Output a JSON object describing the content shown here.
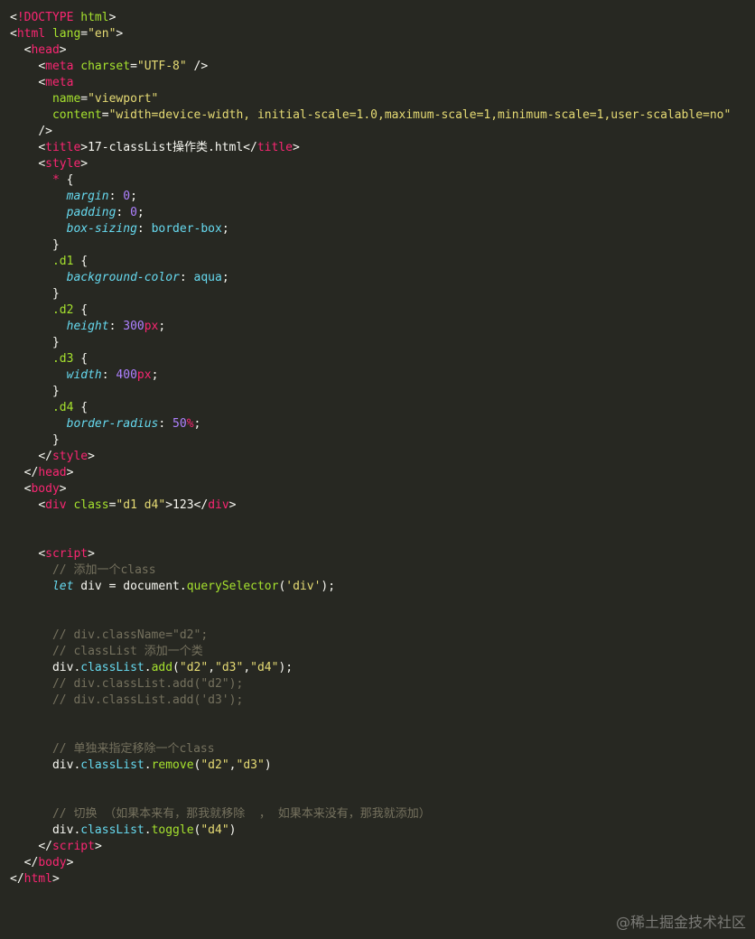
{
  "editor": {
    "lines": [
      [
        [
          "punct",
          "<"
        ],
        [
          "tag",
          "!DOCTYPE"
        ],
        [
          "text",
          " "
        ],
        [
          "attr",
          "html"
        ],
        [
          "punct",
          ">"
        ]
      ],
      [
        [
          "punct",
          "<"
        ],
        [
          "tag",
          "html"
        ],
        [
          "text",
          " "
        ],
        [
          "attr",
          "lang"
        ],
        [
          "punct",
          "="
        ],
        [
          "string",
          "\"en\""
        ],
        [
          "punct",
          ">"
        ]
      ],
      [
        [
          "text",
          "  "
        ],
        [
          "punct",
          "<"
        ],
        [
          "tag",
          "head"
        ],
        [
          "punct",
          ">"
        ]
      ],
      [
        [
          "text",
          "    "
        ],
        [
          "punct",
          "<"
        ],
        [
          "tag",
          "meta"
        ],
        [
          "text",
          " "
        ],
        [
          "attr",
          "charset"
        ],
        [
          "punct",
          "="
        ],
        [
          "string",
          "\"UTF-8\""
        ],
        [
          "text",
          " "
        ],
        [
          "punct",
          "/>"
        ]
      ],
      [
        [
          "text",
          "    "
        ],
        [
          "punct",
          "<"
        ],
        [
          "tag",
          "meta"
        ]
      ],
      [
        [
          "text",
          "      "
        ],
        [
          "attr",
          "name"
        ],
        [
          "punct",
          "="
        ],
        [
          "string",
          "\"viewport\""
        ]
      ],
      [
        [
          "text",
          "      "
        ],
        [
          "attr",
          "content"
        ],
        [
          "punct",
          "="
        ],
        [
          "string",
          "\"width=device-width, initial-scale=1.0,maximum-scale=1,minimum-scale=1,user-scalable=no\""
        ]
      ],
      [
        [
          "text",
          "    "
        ],
        [
          "punct",
          "/>"
        ]
      ],
      [
        [
          "text",
          "    "
        ],
        [
          "punct",
          "<"
        ],
        [
          "tag",
          "title"
        ],
        [
          "punct",
          ">"
        ],
        [
          "text",
          "17-classList操作类.html"
        ],
        [
          "punct",
          "</"
        ],
        [
          "tag",
          "title"
        ],
        [
          "punct",
          ">"
        ]
      ],
      [
        [
          "text",
          "    "
        ],
        [
          "punct",
          "<"
        ],
        [
          "tag",
          "style"
        ],
        [
          "punct",
          ">"
        ]
      ],
      [
        [
          "text",
          "      "
        ],
        [
          "star",
          "*"
        ],
        [
          "text",
          " "
        ],
        [
          "punct",
          "{"
        ]
      ],
      [
        [
          "text",
          "        "
        ],
        [
          "prop",
          "margin"
        ],
        [
          "punct",
          ": "
        ],
        [
          "number",
          "0"
        ],
        [
          "punct",
          ";"
        ]
      ],
      [
        [
          "text",
          "        "
        ],
        [
          "prop",
          "padding"
        ],
        [
          "punct",
          ": "
        ],
        [
          "number",
          "0"
        ],
        [
          "punct",
          ";"
        ]
      ],
      [
        [
          "text",
          "        "
        ],
        [
          "prop",
          "box-sizing"
        ],
        [
          "punct",
          ": "
        ],
        [
          "value",
          "border-box"
        ],
        [
          "punct",
          ";"
        ]
      ],
      [
        [
          "text",
          "      "
        ],
        [
          "punct",
          "}"
        ]
      ],
      [
        [
          "text",
          "      "
        ],
        [
          "selector",
          ".d1"
        ],
        [
          "text",
          " "
        ],
        [
          "punct",
          "{"
        ]
      ],
      [
        [
          "text",
          "        "
        ],
        [
          "prop",
          "background-color"
        ],
        [
          "punct",
          ": "
        ],
        [
          "value",
          "aqua"
        ],
        [
          "punct",
          ";"
        ]
      ],
      [
        [
          "text",
          "      "
        ],
        [
          "punct",
          "}"
        ]
      ],
      [
        [
          "text",
          "      "
        ],
        [
          "selector",
          ".d2"
        ],
        [
          "text",
          " "
        ],
        [
          "punct",
          "{"
        ]
      ],
      [
        [
          "text",
          "        "
        ],
        [
          "prop",
          "height"
        ],
        [
          "punct",
          ": "
        ],
        [
          "number",
          "300"
        ],
        [
          "unit",
          "px"
        ],
        [
          "punct",
          ";"
        ]
      ],
      [
        [
          "text",
          "      "
        ],
        [
          "punct",
          "}"
        ]
      ],
      [
        [
          "text",
          "      "
        ],
        [
          "selector",
          ".d3"
        ],
        [
          "text",
          " "
        ],
        [
          "punct",
          "{"
        ]
      ],
      [
        [
          "text",
          "        "
        ],
        [
          "prop",
          "width"
        ],
        [
          "punct",
          ": "
        ],
        [
          "number",
          "400"
        ],
        [
          "unit",
          "px"
        ],
        [
          "punct",
          ";"
        ]
      ],
      [
        [
          "text",
          "      "
        ],
        [
          "punct",
          "}"
        ]
      ],
      [
        [
          "text",
          "      "
        ],
        [
          "selector",
          ".d4"
        ],
        [
          "text",
          " "
        ],
        [
          "punct",
          "{"
        ]
      ],
      [
        [
          "text",
          "        "
        ],
        [
          "prop",
          "border-radius"
        ],
        [
          "punct",
          ": "
        ],
        [
          "number",
          "50"
        ],
        [
          "unit",
          "%"
        ],
        [
          "punct",
          ";"
        ]
      ],
      [
        [
          "text",
          "      "
        ],
        [
          "punct",
          "}"
        ]
      ],
      [
        [
          "text",
          "    "
        ],
        [
          "punct",
          "</"
        ],
        [
          "tag",
          "style"
        ],
        [
          "punct",
          ">"
        ]
      ],
      [
        [
          "text",
          "  "
        ],
        [
          "punct",
          "</"
        ],
        [
          "tag",
          "head"
        ],
        [
          "punct",
          ">"
        ]
      ],
      [
        [
          "text",
          "  "
        ],
        [
          "punct",
          "<"
        ],
        [
          "tag",
          "body"
        ],
        [
          "punct",
          ">"
        ]
      ],
      [
        [
          "text",
          "    "
        ],
        [
          "punct",
          "<"
        ],
        [
          "tag",
          "div"
        ],
        [
          "text",
          " "
        ],
        [
          "attr",
          "class"
        ],
        [
          "punct",
          "="
        ],
        [
          "string",
          "\"d1 d4\""
        ],
        [
          "punct",
          ">"
        ],
        [
          "text",
          "123"
        ],
        [
          "punct",
          "</"
        ],
        [
          "tag",
          "div"
        ],
        [
          "punct",
          ">"
        ]
      ],
      [],
      [],
      [
        [
          "text",
          "    "
        ],
        [
          "punct",
          "<"
        ],
        [
          "tag",
          "script"
        ],
        [
          "punct",
          ">"
        ]
      ],
      [
        [
          "text",
          "      "
        ],
        [
          "comment",
          "// 添加一个class"
        ]
      ],
      [
        [
          "text",
          "      "
        ],
        [
          "keyword",
          "let"
        ],
        [
          "text",
          " div "
        ],
        [
          "punct",
          "="
        ],
        [
          "text",
          " document"
        ],
        [
          "punct",
          "."
        ],
        [
          "method",
          "querySelector"
        ],
        [
          "punct",
          "("
        ],
        [
          "string",
          "'div'"
        ],
        [
          "punct",
          ");"
        ]
      ],
      [],
      [],
      [
        [
          "text",
          "      "
        ],
        [
          "comment",
          "// div.className=\"d2\";"
        ]
      ],
      [
        [
          "text",
          "      "
        ],
        [
          "comment",
          "// classList 添加一个类"
        ]
      ],
      [
        [
          "text",
          "      "
        ],
        [
          "text",
          "div"
        ],
        [
          "punct",
          "."
        ],
        [
          "value",
          "classList"
        ],
        [
          "punct",
          "."
        ],
        [
          "method",
          "add"
        ],
        [
          "punct",
          "("
        ],
        [
          "string",
          "\"d2\""
        ],
        [
          "punct",
          ","
        ],
        [
          "string",
          "\"d3\""
        ],
        [
          "punct",
          ","
        ],
        [
          "string",
          "\"d4\""
        ],
        [
          "punct",
          ");"
        ]
      ],
      [
        [
          "text",
          "      "
        ],
        [
          "comment",
          "// div.classList.add(\"d2\");"
        ]
      ],
      [
        [
          "text",
          "      "
        ],
        [
          "comment",
          "// div.classList.add('d3');"
        ]
      ],
      [],
      [],
      [
        [
          "text",
          "      "
        ],
        [
          "comment",
          "// 单独来指定移除一个class"
        ]
      ],
      [
        [
          "text",
          "      "
        ],
        [
          "text",
          "div"
        ],
        [
          "punct",
          "."
        ],
        [
          "value",
          "classList"
        ],
        [
          "punct",
          "."
        ],
        [
          "method",
          "remove"
        ],
        [
          "punct",
          "("
        ],
        [
          "string",
          "\"d2\""
        ],
        [
          "punct",
          ","
        ],
        [
          "string",
          "\"d3\""
        ],
        [
          "punct",
          ")"
        ]
      ],
      [],
      [],
      [
        [
          "text",
          "      "
        ],
        [
          "comment",
          "// 切换 （如果本来有，那我就移除  ， 如果本来没有，那我就添加）"
        ]
      ],
      [
        [
          "text",
          "      "
        ],
        [
          "text",
          "div"
        ],
        [
          "punct",
          "."
        ],
        [
          "value",
          "classList"
        ],
        [
          "punct",
          "."
        ],
        [
          "method",
          "toggle"
        ],
        [
          "punct",
          "("
        ],
        [
          "string",
          "\"d4\""
        ],
        [
          "punct",
          ")"
        ]
      ],
      [
        [
          "text",
          "    "
        ],
        [
          "punct",
          "</"
        ],
        [
          "tag",
          "script"
        ],
        [
          "punct",
          ">"
        ]
      ],
      [
        [
          "text",
          "  "
        ],
        [
          "punct",
          "</"
        ],
        [
          "tag",
          "body"
        ],
        [
          "punct",
          ">"
        ]
      ],
      [
        [
          "punct",
          "</"
        ],
        [
          "tag",
          "html"
        ],
        [
          "punct",
          ">"
        ]
      ]
    ]
  },
  "watermark": {
    "text": "@稀土掘金技术社区"
  },
  "colors": {
    "background": "#272822",
    "text": "#f8f8f2",
    "tag": "#f92672",
    "attribute": "#a6e22e",
    "string": "#e6db74",
    "property": "#66d9ef",
    "number": "#ae81ff",
    "comment": "#75715e"
  }
}
